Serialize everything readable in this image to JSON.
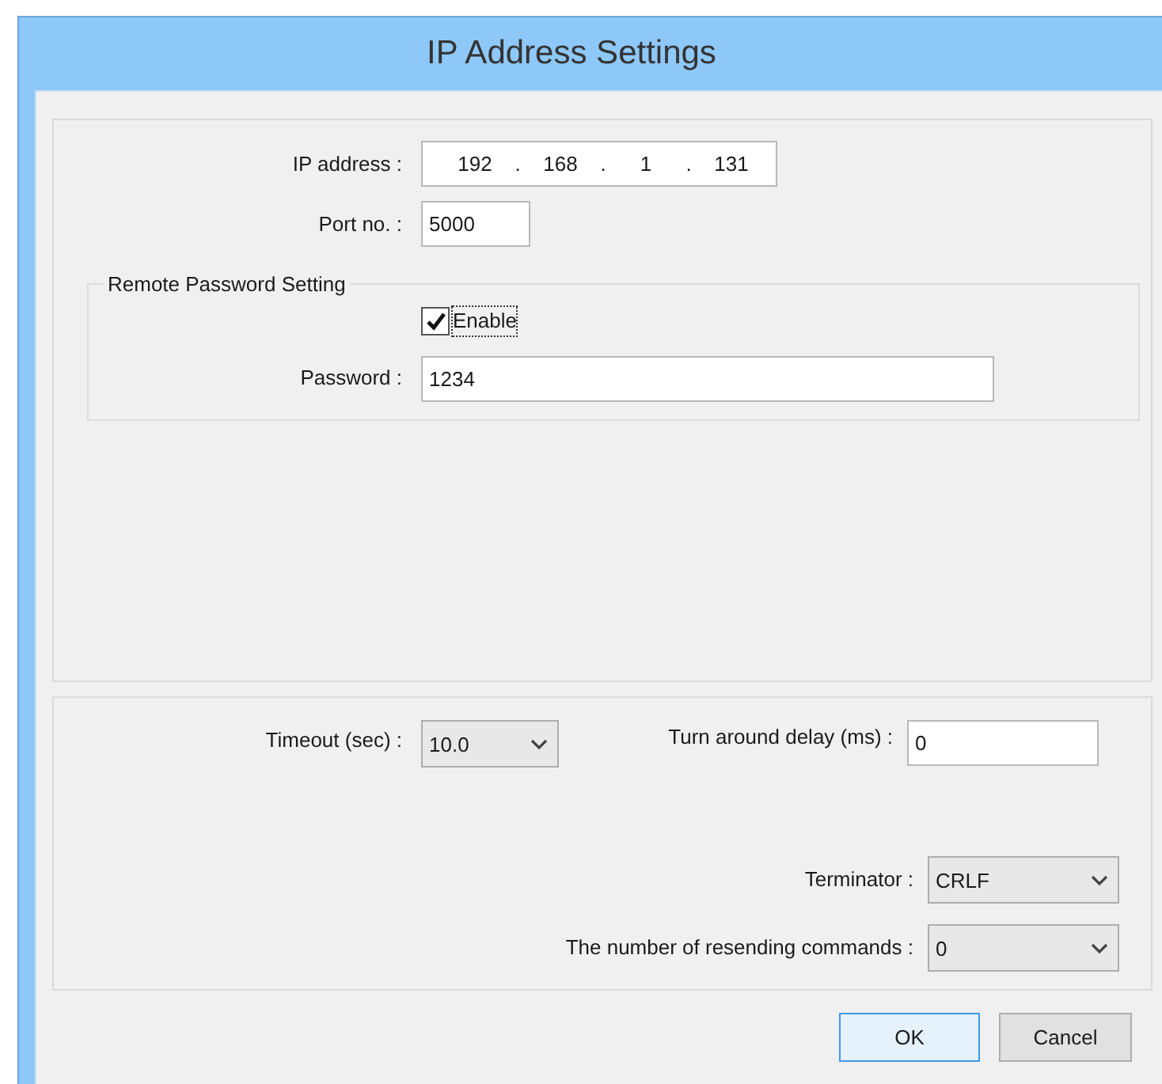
{
  "window": {
    "title": "IP Address Settings"
  },
  "network": {
    "ip_address": {
      "label": "IP address :",
      "octets": [
        "192",
        "168",
        "1",
        "131"
      ],
      "separators": [
        ".",
        ".",
        "."
      ]
    },
    "port": {
      "label": "Port no. :",
      "value": "5000"
    }
  },
  "remote_password": {
    "title": "Remote Password Setting",
    "enable": {
      "label": "Enable",
      "checked": true,
      "focused": true
    },
    "password": {
      "label": "Password :",
      "value": "1234"
    }
  },
  "communication": {
    "timeout": {
      "label": "Timeout (sec) :",
      "value": "10.0"
    },
    "turnaround": {
      "label": "Turn around delay (ms) :",
      "value": "0"
    },
    "terminator": {
      "label": "Terminator :",
      "value": "CRLF"
    },
    "resend": {
      "label": "The number of resending commands :",
      "value": "0"
    }
  },
  "buttons": [
    {
      "label": "OK",
      "default": true
    },
    {
      "label": "Cancel",
      "default": false
    }
  ]
}
